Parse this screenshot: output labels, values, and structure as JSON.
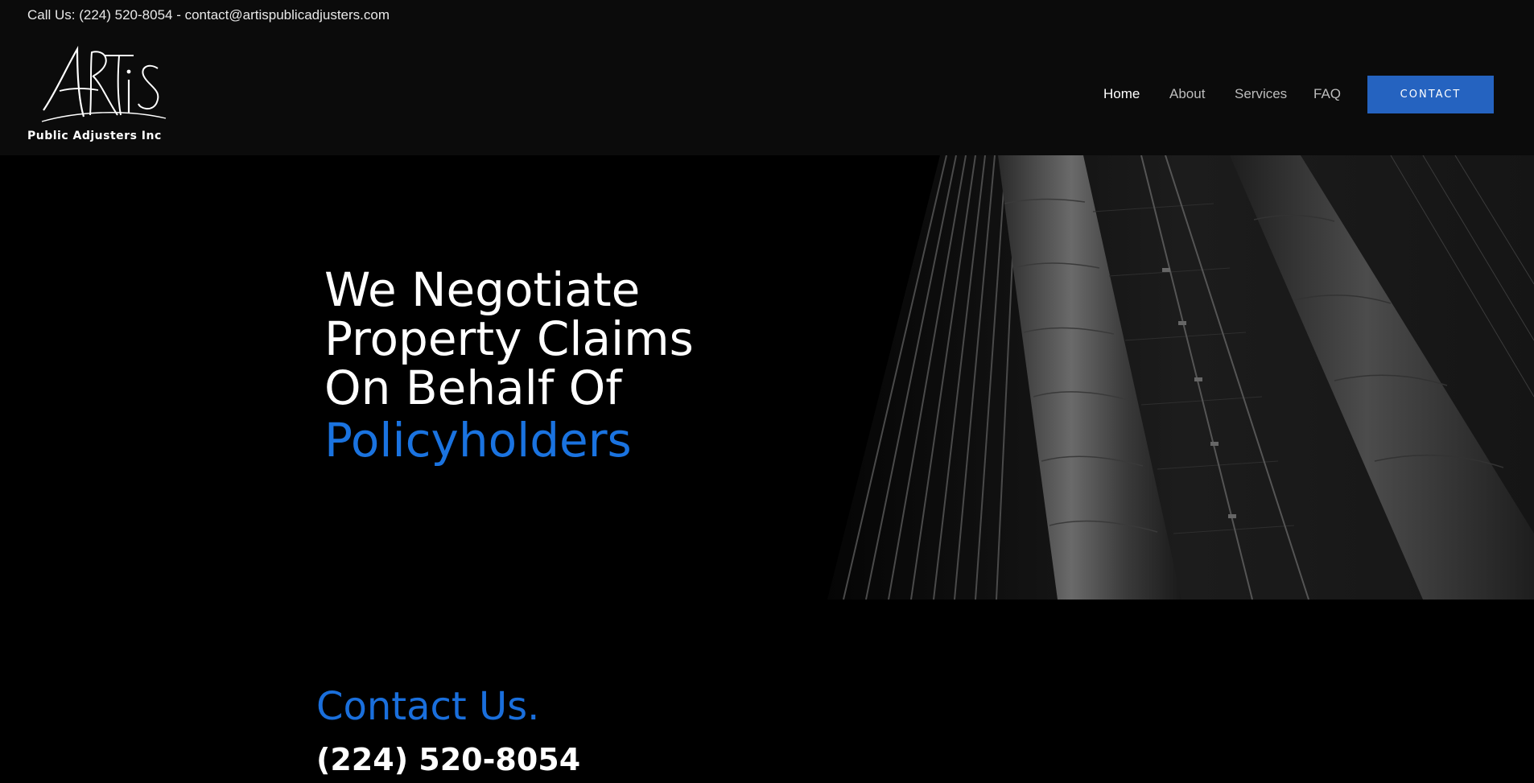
{
  "header": {
    "contact_line": "Call Us: (224) 520-8054 - contact@artispublicadjusters.com",
    "logo": {
      "mark": "Artis",
      "subtitle": "Public Adjusters Inc"
    },
    "nav": [
      {
        "label": "Home",
        "active": true
      },
      {
        "label": "About",
        "active": false
      },
      {
        "label": "Services",
        "active": false
      },
      {
        "label": "FAQ",
        "active": false
      }
    ],
    "contact_button": "CONTACT"
  },
  "hero": {
    "headline_lines": [
      "We Negotiate",
      "Property Claims",
      "On Behalf Of"
    ],
    "headline_accent": "Policyholders",
    "image": "black-and-white skyscraper facade"
  },
  "contact_section": {
    "heading": "Contact Us.",
    "phone": "(224) 520-8054"
  },
  "colors": {
    "accent": "#1a73e0",
    "button": "#2563c0",
    "header_bg": "#0b0b0b",
    "page_bg": "#000000"
  }
}
